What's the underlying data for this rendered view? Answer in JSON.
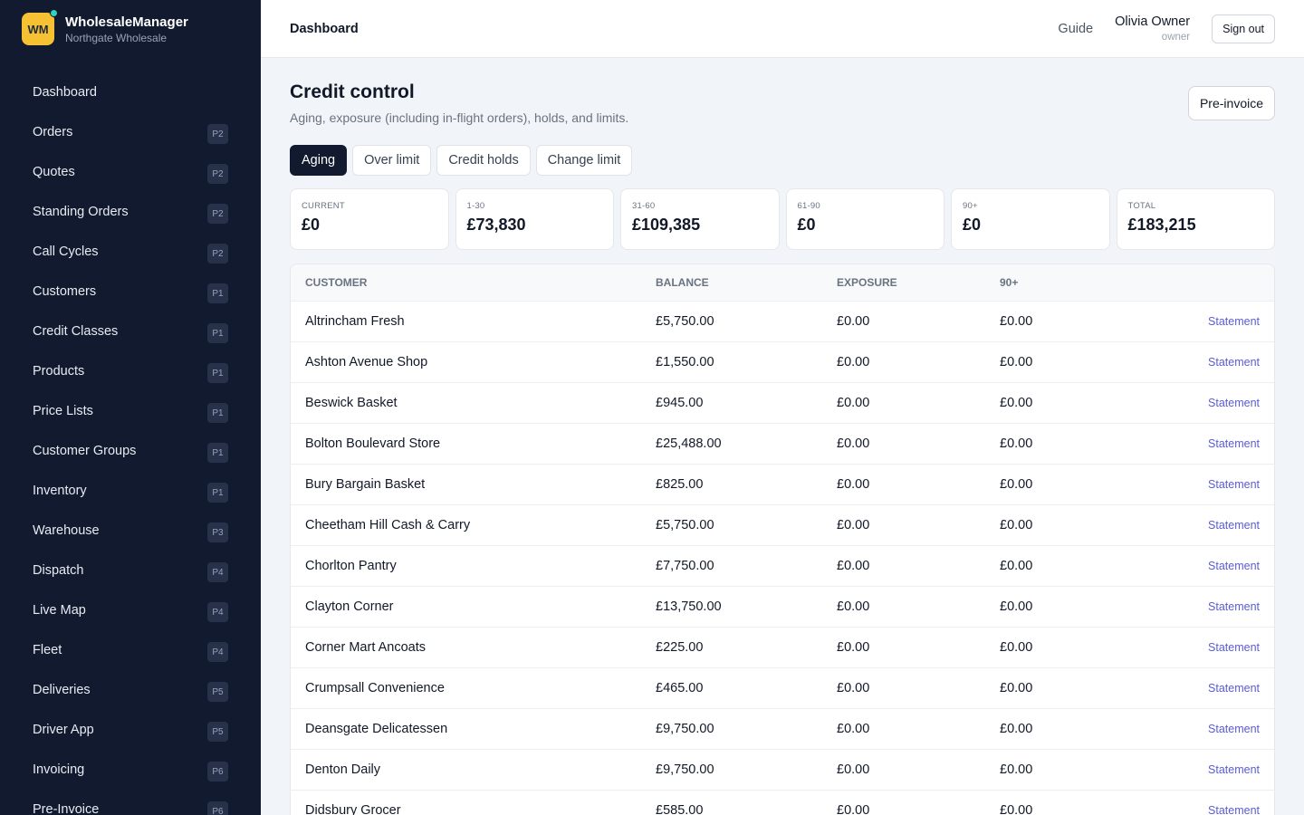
{
  "brand": {
    "logo": "WM",
    "name": "WholesaleManager",
    "org": "Northgate Wholesale"
  },
  "sidebar": {
    "items": [
      {
        "label": "Dashboard",
        "badge": ""
      },
      {
        "label": "Orders",
        "badge": "P2"
      },
      {
        "label": "Quotes",
        "badge": "P2"
      },
      {
        "label": "Standing Orders",
        "badge": "P2"
      },
      {
        "label": "Call Cycles",
        "badge": "P2"
      },
      {
        "label": "Customers",
        "badge": "P1"
      },
      {
        "label": "Credit Classes",
        "badge": "P1"
      },
      {
        "label": "Products",
        "badge": "P1"
      },
      {
        "label": "Price Lists",
        "badge": "P1"
      },
      {
        "label": "Customer Groups",
        "badge": "P1"
      },
      {
        "label": "Inventory",
        "badge": "P1"
      },
      {
        "label": "Warehouse",
        "badge": "P3"
      },
      {
        "label": "Dispatch",
        "badge": "P4"
      },
      {
        "label": "Live Map",
        "badge": "P4"
      },
      {
        "label": "Fleet",
        "badge": "P4"
      },
      {
        "label": "Deliveries",
        "badge": "P5"
      },
      {
        "label": "Driver App",
        "badge": "P5"
      },
      {
        "label": "Invoicing",
        "badge": "P6"
      },
      {
        "label": "Pre-Invoice",
        "badge": "P6"
      }
    ]
  },
  "header": {
    "title": "Dashboard",
    "guide": "Guide",
    "user_name": "Olivia Owner",
    "user_role": "owner",
    "signout": "Sign out"
  },
  "page": {
    "title": "Credit control",
    "subtitle": "Aging, exposure (including in-flight orders), holds, and limits.",
    "preinvoice": "Pre-invoice"
  },
  "tabs": [
    {
      "label": "Aging",
      "active": true
    },
    {
      "label": "Over limit",
      "active": false
    },
    {
      "label": "Credit holds",
      "active": false
    },
    {
      "label": "Change limit",
      "active": false
    }
  ],
  "cards": [
    {
      "label": "CURRENT",
      "value": "£0"
    },
    {
      "label": "1-30",
      "value": "£73,830"
    },
    {
      "label": "31-60",
      "value": "£109,385"
    },
    {
      "label": "61-90",
      "value": "£0"
    },
    {
      "label": "90+",
      "value": "£0"
    },
    {
      "label": "TOTAL",
      "value": "£183,215"
    }
  ],
  "table": {
    "headers": {
      "customer": "CUSTOMER",
      "balance": "BALANCE",
      "exposure": "EXPOSURE",
      "ninety": "90+"
    },
    "action_label": "Statement",
    "rows": [
      {
        "customer": "Altrincham Fresh",
        "balance": "£5,750.00",
        "exposure": "£0.00",
        "ninety": "£0.00"
      },
      {
        "customer": "Ashton Avenue Shop",
        "balance": "£1,550.00",
        "exposure": "£0.00",
        "ninety": "£0.00"
      },
      {
        "customer": "Beswick Basket",
        "balance": "£945.00",
        "exposure": "£0.00",
        "ninety": "£0.00"
      },
      {
        "customer": "Bolton Boulevard Store",
        "balance": "£25,488.00",
        "exposure": "£0.00",
        "ninety": "£0.00"
      },
      {
        "customer": "Bury Bargain Basket",
        "balance": "£825.00",
        "exposure": "£0.00",
        "ninety": "£0.00"
      },
      {
        "customer": "Cheetham Hill Cash & Carry",
        "balance": "£5,750.00",
        "exposure": "£0.00",
        "ninety": "£0.00"
      },
      {
        "customer": "Chorlton Pantry",
        "balance": "£7,750.00",
        "exposure": "£0.00",
        "ninety": "£0.00"
      },
      {
        "customer": "Clayton Corner",
        "balance": "£13,750.00",
        "exposure": "£0.00",
        "ninety": "£0.00"
      },
      {
        "customer": "Corner Mart Ancoats",
        "balance": "£225.00",
        "exposure": "£0.00",
        "ninety": "£0.00"
      },
      {
        "customer": "Crumpsall Convenience",
        "balance": "£465.00",
        "exposure": "£0.00",
        "ninety": "£0.00"
      },
      {
        "customer": "Deansgate Delicatessen",
        "balance": "£9,750.00",
        "exposure": "£0.00",
        "ninety": "£0.00"
      },
      {
        "customer": "Denton Daily",
        "balance": "£9,750.00",
        "exposure": "£0.00",
        "ninety": "£0.00"
      },
      {
        "customer": "Didsbury Grocer",
        "balance": "£585.00",
        "exposure": "£0.00",
        "ninety": "£0.00"
      }
    ]
  }
}
